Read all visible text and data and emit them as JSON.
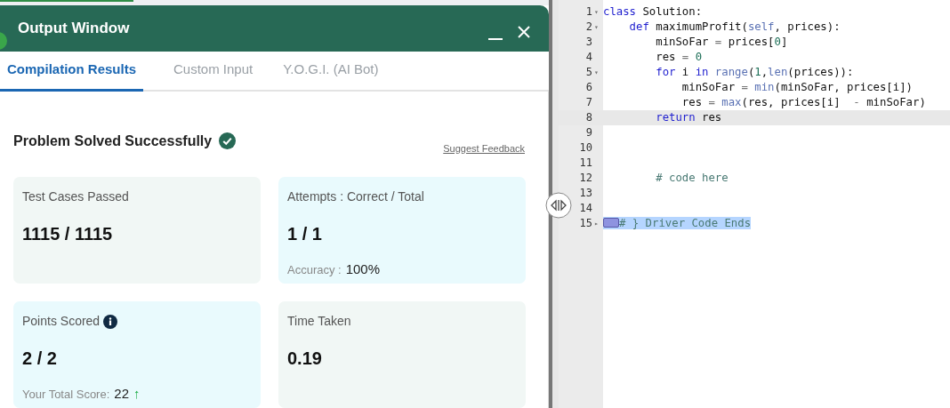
{
  "output_window": {
    "title": "Output Window",
    "tabs": [
      {
        "label": "Compilation Results",
        "selected": true
      },
      {
        "label": "Custom Input",
        "selected": false
      },
      {
        "label": "Y.O.G.I. (AI Bot)",
        "selected": false
      }
    ],
    "result": {
      "heading": "Problem Solved Successfully",
      "solved": true,
      "feedback_link": "Suggest Feedback"
    },
    "cards": [
      {
        "label": "Test Cases Passed",
        "value": "1115 / 1115",
        "color": "#f1f7f5",
        "info": false
      },
      {
        "label": "Attempts : Correct / Total",
        "value": "1 / 1",
        "color": "#e9fafd",
        "info": false,
        "footer": {
          "label": "Accuracy :",
          "value": "100%"
        }
      },
      {
        "label": "Points Scored",
        "value": "2 / 2",
        "color": "#e9fafd",
        "info": true,
        "footer": {
          "label": "Your Total Score:",
          "value": "22",
          "trend": "↑"
        }
      },
      {
        "label": "Time Taken",
        "value": "0.19",
        "color": "#f1f7f5",
        "info": false
      }
    ]
  },
  "editor": {
    "lines": [
      {
        "number": "1",
        "fold": "▾",
        "active": false,
        "tokens": [
          {
            "kind": "kw",
            "text": "class"
          },
          {
            "kind": "plain",
            "text": " Solution:"
          }
        ]
      },
      {
        "number": "2",
        "fold": "▾",
        "active": false,
        "tokens": [
          {
            "kind": "kw",
            "text": "    def"
          },
          {
            "kind": "plain",
            "text": " maximumProfit("
          },
          {
            "kind": "builtin",
            "text": "self"
          },
          {
            "kind": "plain",
            "text": ", prices):"
          }
        ]
      },
      {
        "number": "3",
        "active": false,
        "tokens": [
          {
            "kind": "plain",
            "text": "        minSoFar "
          },
          {
            "kind": "op",
            "text": "= "
          },
          {
            "kind": "plain",
            "text": "prices["
          },
          {
            "kind": "num",
            "text": "0"
          },
          {
            "kind": "plain",
            "text": "]"
          }
        ]
      },
      {
        "number": "4",
        "active": false,
        "tokens": [
          {
            "kind": "plain",
            "text": "        res "
          },
          {
            "kind": "op",
            "text": "= "
          },
          {
            "kind": "num",
            "text": "0"
          }
        ]
      },
      {
        "number": "5",
        "fold": "▾",
        "active": false,
        "tokens": [
          {
            "kind": "kw",
            "text": "        for"
          },
          {
            "kind": "plain",
            "text": " i "
          },
          {
            "kind": "kw",
            "text": "in"
          },
          {
            "kind": "builtin",
            "text": " range"
          },
          {
            "kind": "plain",
            "text": "("
          },
          {
            "kind": "num",
            "text": "1"
          },
          {
            "kind": "plain",
            "text": ","
          },
          {
            "kind": "builtin",
            "text": "len"
          },
          {
            "kind": "plain",
            "text": "(prices)):"
          }
        ]
      },
      {
        "number": "6",
        "active": false,
        "tokens": [
          {
            "kind": "plain",
            "text": "            minSoFar "
          },
          {
            "kind": "op",
            "text": "= "
          },
          {
            "kind": "builtin",
            "text": "min"
          },
          {
            "kind": "plain",
            "text": "(minSoFar, prices[i])"
          }
        ]
      },
      {
        "number": "7",
        "active": false,
        "tokens": [
          {
            "kind": "plain",
            "text": "            res "
          },
          {
            "kind": "op",
            "text": "= "
          },
          {
            "kind": "builtin",
            "text": "max"
          },
          {
            "kind": "plain",
            "text": "(res, prices[i]  "
          },
          {
            "kind": "op",
            "text": "- "
          },
          {
            "kind": "plain",
            "text": "minSoFar)"
          }
        ]
      },
      {
        "number": "8",
        "active": true,
        "tokens": [
          {
            "kind": "kw",
            "text": "        return"
          },
          {
            "kind": "plain",
            "text": " res"
          }
        ]
      },
      {
        "number": "9",
        "active": false
      },
      {
        "number": "10",
        "active": false
      },
      {
        "number": "11",
        "active": false
      },
      {
        "number": "12",
        "active": false,
        "tokens": [
          {
            "kind": "comment",
            "text": "        # code here"
          }
        ]
      },
      {
        "number": "13",
        "active": false
      },
      {
        "number": "14",
        "active": false
      },
      {
        "number": "15",
        "fold": "▸",
        "active": false,
        "folded_marker": true,
        "tokens": [
          {
            "kind": "comment",
            "text": "# } Driver Code Ends",
            "selected": true
          }
        ]
      }
    ]
  }
}
